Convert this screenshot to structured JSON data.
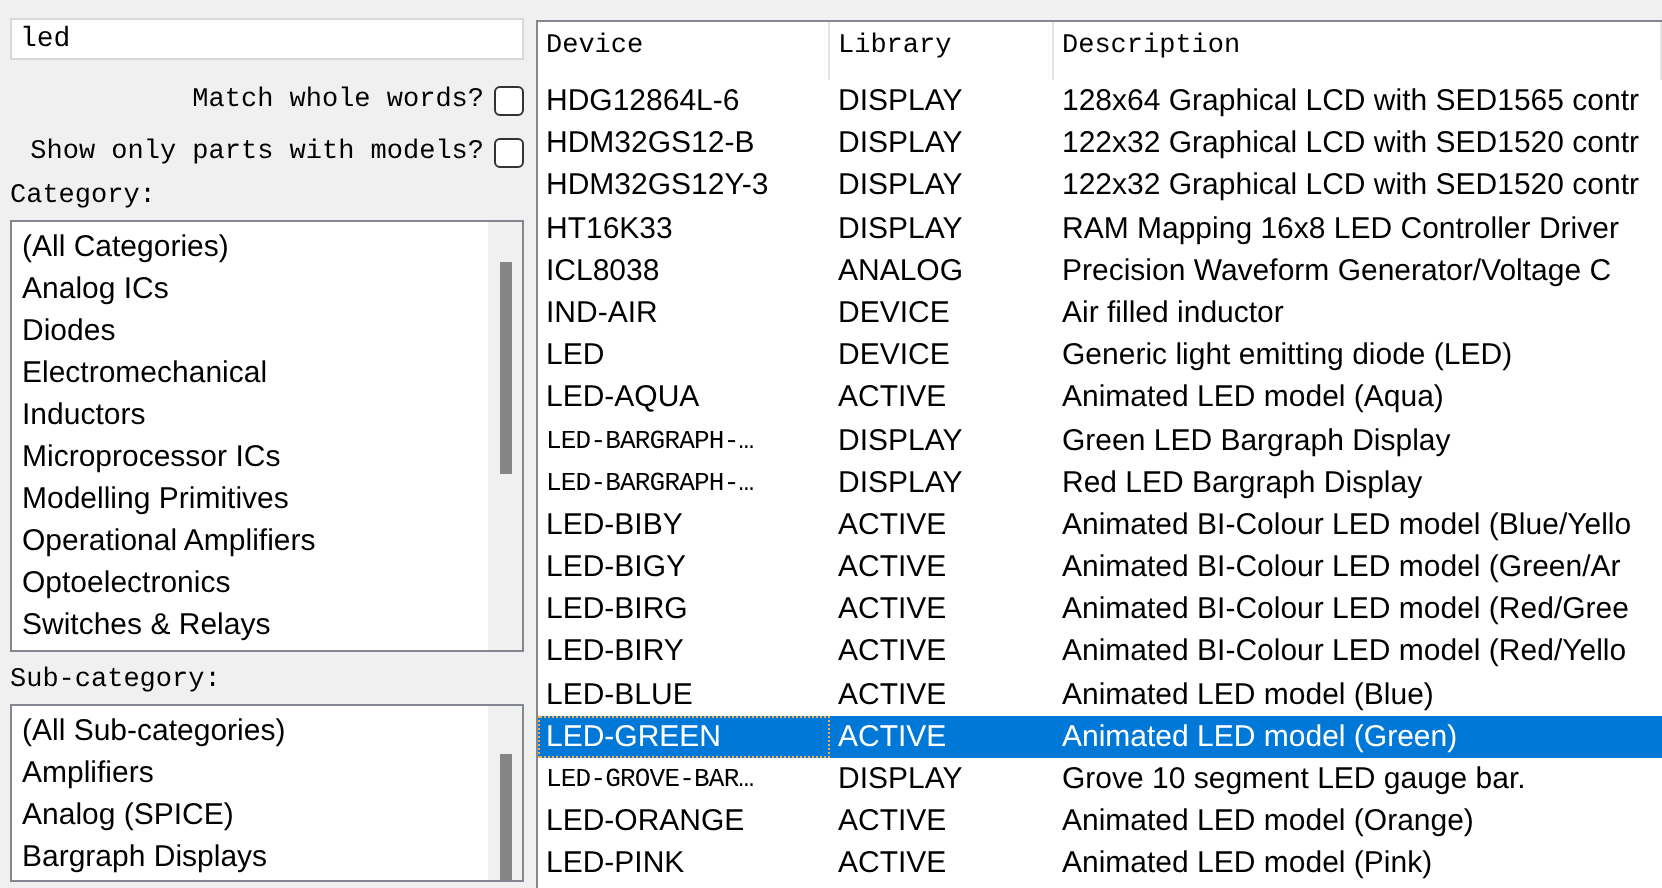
{
  "keywords": {
    "value": "led"
  },
  "options": [
    {
      "label": "Match whole words?",
      "checked": false
    },
    {
      "label": "Show only parts with models?",
      "checked": false
    }
  ],
  "category": {
    "label": "Category:",
    "items": [
      {
        "label": "(All Categories)",
        "selected": false
      },
      {
        "label": "Analog ICs",
        "selected": false
      },
      {
        "label": "Diodes",
        "selected": false
      },
      {
        "label": "Electromechanical",
        "selected": false
      },
      {
        "label": "Inductors",
        "selected": false
      },
      {
        "label": "Microprocessor ICs",
        "selected": false
      },
      {
        "label": "Modelling Primitives",
        "selected": false
      },
      {
        "label": "Operational Amplifiers",
        "selected": false
      },
      {
        "label": "Optoelectronics",
        "selected": false
      },
      {
        "label": "Switches & Relays",
        "selected": false
      }
    ]
  },
  "sub_category": {
    "label": "Sub-category:",
    "items": [
      {
        "label": "(All Sub-categories)",
        "selected": false
      },
      {
        "label": "Amplifiers",
        "selected": false
      },
      {
        "label": "Analog (SPICE)",
        "selected": false
      },
      {
        "label": "Bargraph Displays",
        "selected": false
      }
    ]
  },
  "results": {
    "columns": [
      "Device",
      "Library",
      "Description"
    ],
    "rows": [
      {
        "device": "HDG12864L-6",
        "library": "DISPLAY",
        "description": "128x64 Graphical LCD with SED1565 contr",
        "selected": false
      },
      {
        "device": "HDM32GS12-B",
        "library": "DISPLAY",
        "description": "122x32 Graphical LCD with SED1520 contr",
        "selected": false
      },
      {
        "device": "HDM32GS12Y-3",
        "library": "DISPLAY",
        "description": "122x32 Graphical LCD with SED1520 contr",
        "selected": false
      },
      {
        "device": "HT16K33",
        "library": "DISPLAY",
        "description": "RAM Mapping 16x8 LED Controller Driver",
        "selected": false
      },
      {
        "device": "ICL8038",
        "library": "ANALOG",
        "description": "Precision Waveform Generator/Voltage C",
        "selected": false
      },
      {
        "device": "IND-AIR",
        "library": "DEVICE",
        "description": "Air filled inductor",
        "selected": false
      },
      {
        "device": "LED",
        "library": "DEVICE",
        "description": "Generic light emitting diode (LED)",
        "selected": false
      },
      {
        "device": "LED-AQUA",
        "library": "ACTIVE",
        "description": "Animated LED model (Aqua)",
        "selected": false
      },
      {
        "device": "LED-BARGRAPH-…",
        "library": "DISPLAY",
        "description": "Green LED Bargraph Display",
        "selected": false
      },
      {
        "device": "LED-BARGRAPH-…",
        "library": "DISPLAY",
        "description": "Red LED Bargraph Display",
        "selected": false
      },
      {
        "device": "LED-BIBY",
        "library": "ACTIVE",
        "description": "Animated BI-Colour LED model (Blue/Yello",
        "selected": false
      },
      {
        "device": "LED-BIGY",
        "library": "ACTIVE",
        "description": "Animated BI-Colour LED model (Green/Ar",
        "selected": false
      },
      {
        "device": "LED-BIRG",
        "library": "ACTIVE",
        "description": "Animated BI-Colour LED model (Red/Gree",
        "selected": false
      },
      {
        "device": "LED-BIRY",
        "library": "ACTIVE",
        "description": "Animated BI-Colour LED model (Red/Yello",
        "selected": false
      },
      {
        "device": "LED-BLUE",
        "library": "ACTIVE",
        "description": "Animated LED model (Blue)",
        "selected": false
      },
      {
        "device": "LED-GREEN",
        "library": "ACTIVE",
        "description": "Animated LED model (Green)",
        "selected": true
      },
      {
        "device": "LED-GROVE-BAR…",
        "library": "DISPLAY",
        "description": "Grove 10 segment LED gauge bar.",
        "selected": false
      },
      {
        "device": "LED-ORANGE",
        "library": "ACTIVE",
        "description": "Animated LED model (Orange)",
        "selected": false
      },
      {
        "device": "LED-PINK",
        "library": "ACTIVE",
        "description": "Animated LED model (Pink)",
        "selected": false
      }
    ]
  }
}
